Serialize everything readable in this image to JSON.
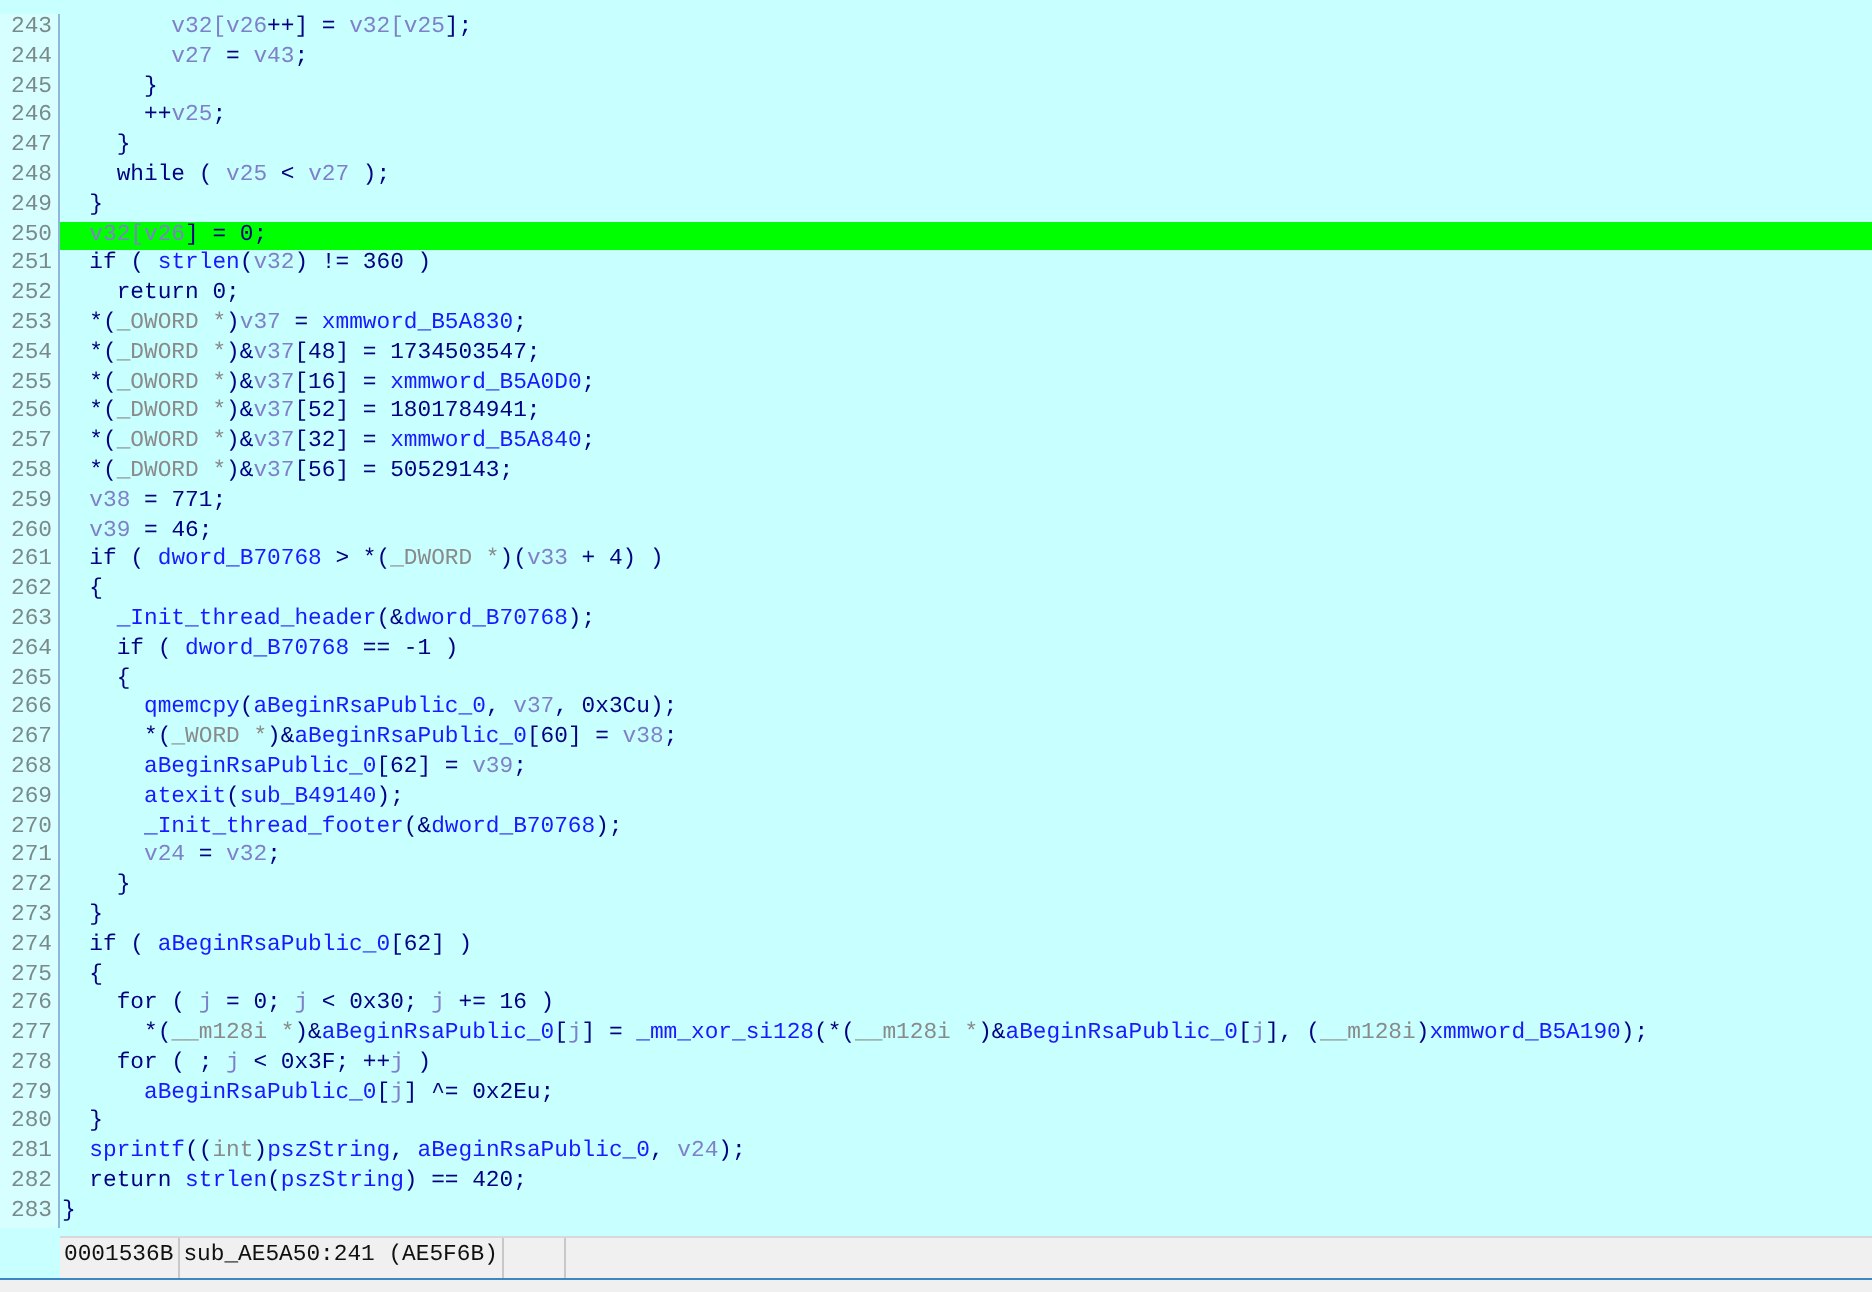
{
  "lines": [
    {
      "number": "243",
      "selected": false,
      "tokens": [
        {
          "kind": "var",
          "text": "        v32[v26"
        },
        {
          "kind": "plain",
          "text": "++] = "
        },
        {
          "kind": "var",
          "text": "v32[v25"
        },
        {
          "kind": "plain",
          "text": "];"
        }
      ]
    },
    {
      "number": "244",
      "selected": false,
      "tokens": [
        {
          "kind": "var",
          "text": "        v27"
        },
        {
          "kind": "plain",
          "text": " = "
        },
        {
          "kind": "var",
          "text": "v43"
        },
        {
          "kind": "plain",
          "text": ";"
        }
      ]
    },
    {
      "number": "245",
      "selected": false,
      "tokens": [
        {
          "kind": "plain",
          "text": "      }"
        }
      ]
    },
    {
      "number": "246",
      "selected": false,
      "tokens": [
        {
          "kind": "plain",
          "text": "      ++"
        },
        {
          "kind": "var",
          "text": "v25"
        },
        {
          "kind": "plain",
          "text": ";"
        }
      ]
    },
    {
      "number": "247",
      "selected": false,
      "tokens": [
        {
          "kind": "plain",
          "text": "    }"
        }
      ]
    },
    {
      "number": "248",
      "selected": false,
      "tokens": [
        {
          "kind": "plain",
          "text": "    while ( "
        },
        {
          "kind": "var",
          "text": "v25"
        },
        {
          "kind": "plain",
          "text": " < "
        },
        {
          "kind": "var",
          "text": "v27"
        },
        {
          "kind": "plain",
          "text": " );"
        }
      ]
    },
    {
      "number": "249",
      "selected": false,
      "tokens": [
        {
          "kind": "plain",
          "text": "  }"
        }
      ]
    },
    {
      "number": "250",
      "selected": true,
      "tokens": [
        {
          "kind": "var",
          "text": "  v32[v26"
        },
        {
          "kind": "plain",
          "text": "] = 0;"
        }
      ]
    },
    {
      "number": "251",
      "selected": false,
      "tokens": [
        {
          "kind": "plain",
          "text": "  if ( "
        },
        {
          "kind": "name",
          "text": "strlen"
        },
        {
          "kind": "plain",
          "text": "("
        },
        {
          "kind": "var",
          "text": "v32"
        },
        {
          "kind": "plain",
          "text": ") != 360 )"
        }
      ]
    },
    {
      "number": "252",
      "selected": false,
      "tokens": [
        {
          "kind": "plain",
          "text": "    return 0;"
        }
      ]
    },
    {
      "number": "253",
      "selected": false,
      "tokens": [
        {
          "kind": "plain",
          "text": "  *("
        },
        {
          "kind": "type",
          "text": "_OWORD *"
        },
        {
          "kind": "plain",
          "text": ")"
        },
        {
          "kind": "var",
          "text": "v37"
        },
        {
          "kind": "plain",
          "text": " = "
        },
        {
          "kind": "name",
          "text": "xmmword_B5A830"
        },
        {
          "kind": "plain",
          "text": ";"
        }
      ]
    },
    {
      "number": "254",
      "selected": false,
      "tokens": [
        {
          "kind": "plain",
          "text": "  *("
        },
        {
          "kind": "type",
          "text": "_DWORD *"
        },
        {
          "kind": "plain",
          "text": ")&"
        },
        {
          "kind": "var",
          "text": "v37"
        },
        {
          "kind": "plain",
          "text": "[48] = 1734503547;"
        }
      ]
    },
    {
      "number": "255",
      "selected": false,
      "tokens": [
        {
          "kind": "plain",
          "text": "  *("
        },
        {
          "kind": "type",
          "text": "_OWORD *"
        },
        {
          "kind": "plain",
          "text": ")&"
        },
        {
          "kind": "var",
          "text": "v37"
        },
        {
          "kind": "plain",
          "text": "[16] = "
        },
        {
          "kind": "name",
          "text": "xmmword_B5A0D0"
        },
        {
          "kind": "plain",
          "text": ";"
        }
      ]
    },
    {
      "number": "256",
      "selected": false,
      "tokens": [
        {
          "kind": "plain",
          "text": "  *("
        },
        {
          "kind": "type",
          "text": "_DWORD *"
        },
        {
          "kind": "plain",
          "text": ")&"
        },
        {
          "kind": "var",
          "text": "v37"
        },
        {
          "kind": "plain",
          "text": "[52] = 1801784941;"
        }
      ]
    },
    {
      "number": "257",
      "selected": false,
      "tokens": [
        {
          "kind": "plain",
          "text": "  *("
        },
        {
          "kind": "type",
          "text": "_OWORD *"
        },
        {
          "kind": "plain",
          "text": ")&"
        },
        {
          "kind": "var",
          "text": "v37"
        },
        {
          "kind": "plain",
          "text": "[32] = "
        },
        {
          "kind": "name",
          "text": "xmmword_B5A840"
        },
        {
          "kind": "plain",
          "text": ";"
        }
      ]
    },
    {
      "number": "258",
      "selected": false,
      "tokens": [
        {
          "kind": "plain",
          "text": "  *("
        },
        {
          "kind": "type",
          "text": "_DWORD *"
        },
        {
          "kind": "plain",
          "text": ")&"
        },
        {
          "kind": "var",
          "text": "v37"
        },
        {
          "kind": "plain",
          "text": "[56] = 50529143;"
        }
      ]
    },
    {
      "number": "259",
      "selected": false,
      "tokens": [
        {
          "kind": "var",
          "text": "  v38"
        },
        {
          "kind": "plain",
          "text": " = 771;"
        }
      ]
    },
    {
      "number": "260",
      "selected": false,
      "tokens": [
        {
          "kind": "var",
          "text": "  v39"
        },
        {
          "kind": "plain",
          "text": " = 46;"
        }
      ]
    },
    {
      "number": "261",
      "selected": false,
      "tokens": [
        {
          "kind": "plain",
          "text": "  if ( "
        },
        {
          "kind": "name",
          "text": "dword_B70768"
        },
        {
          "kind": "plain",
          "text": " > *("
        },
        {
          "kind": "type",
          "text": "_DWORD *"
        },
        {
          "kind": "plain",
          "text": ")("
        },
        {
          "kind": "var",
          "text": "v33"
        },
        {
          "kind": "plain",
          "text": " + 4) )"
        }
      ]
    },
    {
      "number": "262",
      "selected": false,
      "tokens": [
        {
          "kind": "plain",
          "text": "  {"
        }
      ]
    },
    {
      "number": "263",
      "selected": false,
      "tokens": [
        {
          "kind": "name",
          "text": "    _Init_thread_header"
        },
        {
          "kind": "plain",
          "text": "(&"
        },
        {
          "kind": "name",
          "text": "dword_B70768"
        },
        {
          "kind": "plain",
          "text": ");"
        }
      ]
    },
    {
      "number": "264",
      "selected": false,
      "tokens": [
        {
          "kind": "plain",
          "text": "    if ( "
        },
        {
          "kind": "name",
          "text": "dword_B70768"
        },
        {
          "kind": "plain",
          "text": " == -1 )"
        }
      ]
    },
    {
      "number": "265",
      "selected": false,
      "tokens": [
        {
          "kind": "plain",
          "text": "    {"
        }
      ]
    },
    {
      "number": "266",
      "selected": false,
      "tokens": [
        {
          "kind": "name",
          "text": "      qmemcpy"
        },
        {
          "kind": "plain",
          "text": "("
        },
        {
          "kind": "name",
          "text": "aBeginRsaPublic_0"
        },
        {
          "kind": "plain",
          "text": ", "
        },
        {
          "kind": "var",
          "text": "v37"
        },
        {
          "kind": "plain",
          "text": ", 0x3Cu);"
        }
      ]
    },
    {
      "number": "267",
      "selected": false,
      "tokens": [
        {
          "kind": "plain",
          "text": "      *("
        },
        {
          "kind": "type",
          "text": "_WORD *"
        },
        {
          "kind": "plain",
          "text": ")&"
        },
        {
          "kind": "name",
          "text": "aBeginRsaPublic_0"
        },
        {
          "kind": "plain",
          "text": "[60] = "
        },
        {
          "kind": "var",
          "text": "v38"
        },
        {
          "kind": "plain",
          "text": ";"
        }
      ]
    },
    {
      "number": "268",
      "selected": false,
      "tokens": [
        {
          "kind": "name",
          "text": "      aBeginRsaPublic_0"
        },
        {
          "kind": "plain",
          "text": "[62] = "
        },
        {
          "kind": "var",
          "text": "v39"
        },
        {
          "kind": "plain",
          "text": ";"
        }
      ]
    },
    {
      "number": "269",
      "selected": false,
      "tokens": [
        {
          "kind": "name",
          "text": "      atexit"
        },
        {
          "kind": "plain",
          "text": "("
        },
        {
          "kind": "name",
          "text": "sub_B49140"
        },
        {
          "kind": "plain",
          "text": ");"
        }
      ]
    },
    {
      "number": "270",
      "selected": false,
      "tokens": [
        {
          "kind": "name",
          "text": "      _Init_thread_footer"
        },
        {
          "kind": "plain",
          "text": "(&"
        },
        {
          "kind": "name",
          "text": "dword_B70768"
        },
        {
          "kind": "plain",
          "text": ");"
        }
      ]
    },
    {
      "number": "271",
      "selected": false,
      "tokens": [
        {
          "kind": "var",
          "text": "      v24"
        },
        {
          "kind": "plain",
          "text": " = "
        },
        {
          "kind": "var",
          "text": "v32"
        },
        {
          "kind": "plain",
          "text": ";"
        }
      ]
    },
    {
      "number": "272",
      "selected": false,
      "tokens": [
        {
          "kind": "plain",
          "text": "    }"
        }
      ]
    },
    {
      "number": "273",
      "selected": false,
      "tokens": [
        {
          "kind": "plain",
          "text": "  }"
        }
      ]
    },
    {
      "number": "274",
      "selected": false,
      "tokens": [
        {
          "kind": "plain",
          "text": "  if ( "
        },
        {
          "kind": "name",
          "text": "aBeginRsaPublic_0"
        },
        {
          "kind": "plain",
          "text": "[62] )"
        }
      ]
    },
    {
      "number": "275",
      "selected": false,
      "tokens": [
        {
          "kind": "plain",
          "text": "  {"
        }
      ]
    },
    {
      "number": "276",
      "selected": false,
      "tokens": [
        {
          "kind": "plain",
          "text": "    for ( "
        },
        {
          "kind": "var",
          "text": "j"
        },
        {
          "kind": "plain",
          "text": " = 0; "
        },
        {
          "kind": "var",
          "text": "j"
        },
        {
          "kind": "plain",
          "text": " < 0x30; "
        },
        {
          "kind": "var",
          "text": "j"
        },
        {
          "kind": "plain",
          "text": " += 16 )"
        }
      ]
    },
    {
      "number": "277",
      "selected": false,
      "tokens": [
        {
          "kind": "plain",
          "text": "      *("
        },
        {
          "kind": "type",
          "text": "__m128i *"
        },
        {
          "kind": "plain",
          "text": ")&"
        },
        {
          "kind": "name",
          "text": "aBeginRsaPublic_0"
        },
        {
          "kind": "plain",
          "text": "["
        },
        {
          "kind": "var",
          "text": "j"
        },
        {
          "kind": "plain",
          "text": "] = "
        },
        {
          "kind": "name",
          "text": "_mm_xor_si128"
        },
        {
          "kind": "plain",
          "text": "(*("
        },
        {
          "kind": "type",
          "text": "__m128i *"
        },
        {
          "kind": "plain",
          "text": ")&"
        },
        {
          "kind": "name",
          "text": "aBeginRsaPublic_0"
        },
        {
          "kind": "plain",
          "text": "["
        },
        {
          "kind": "var",
          "text": "j"
        },
        {
          "kind": "plain",
          "text": "], ("
        },
        {
          "kind": "type",
          "text": "__m128i"
        },
        {
          "kind": "plain",
          "text": ")"
        },
        {
          "kind": "name",
          "text": "xmmword_B5A190"
        },
        {
          "kind": "plain",
          "text": ");"
        }
      ]
    },
    {
      "number": "278",
      "selected": false,
      "tokens": [
        {
          "kind": "plain",
          "text": "    for ( ; "
        },
        {
          "kind": "var",
          "text": "j"
        },
        {
          "kind": "plain",
          "text": " < 0x3F; ++"
        },
        {
          "kind": "var",
          "text": "j"
        },
        {
          "kind": "plain",
          "text": " )"
        }
      ]
    },
    {
      "number": "279",
      "selected": false,
      "tokens": [
        {
          "kind": "name",
          "text": "      aBeginRsaPublic_0"
        },
        {
          "kind": "plain",
          "text": "["
        },
        {
          "kind": "var",
          "text": "j"
        },
        {
          "kind": "plain",
          "text": "] ^= 0x2Eu;"
        }
      ]
    },
    {
      "number": "280",
      "selected": false,
      "tokens": [
        {
          "kind": "plain",
          "text": "  }"
        }
      ]
    },
    {
      "number": "281",
      "selected": false,
      "tokens": [
        {
          "kind": "name",
          "text": "  sprintf"
        },
        {
          "kind": "plain",
          "text": "(("
        },
        {
          "kind": "type",
          "text": "int"
        },
        {
          "kind": "plain",
          "text": ")"
        },
        {
          "kind": "name",
          "text": "pszString"
        },
        {
          "kind": "plain",
          "text": ", "
        },
        {
          "kind": "name",
          "text": "aBeginRsaPublic_0"
        },
        {
          "kind": "plain",
          "text": ", "
        },
        {
          "kind": "var",
          "text": "v24"
        },
        {
          "kind": "plain",
          "text": ");"
        }
      ]
    },
    {
      "number": "282",
      "selected": false,
      "tokens": [
        {
          "kind": "plain",
          "text": "  return "
        },
        {
          "kind": "name",
          "text": "strlen"
        },
        {
          "kind": "plain",
          "text": "("
        },
        {
          "kind": "name",
          "text": "pszString"
        },
        {
          "kind": "plain",
          "text": ") == 420;"
        }
      ]
    },
    {
      "number": "283",
      "selected": false,
      "tokens": [
        {
          "kind": "plain",
          "text": "}"
        }
      ]
    }
  ],
  "status_bar": {
    "offset": "0001536B",
    "location": "sub_AE5A50:241 (AE5F6B)"
  }
}
